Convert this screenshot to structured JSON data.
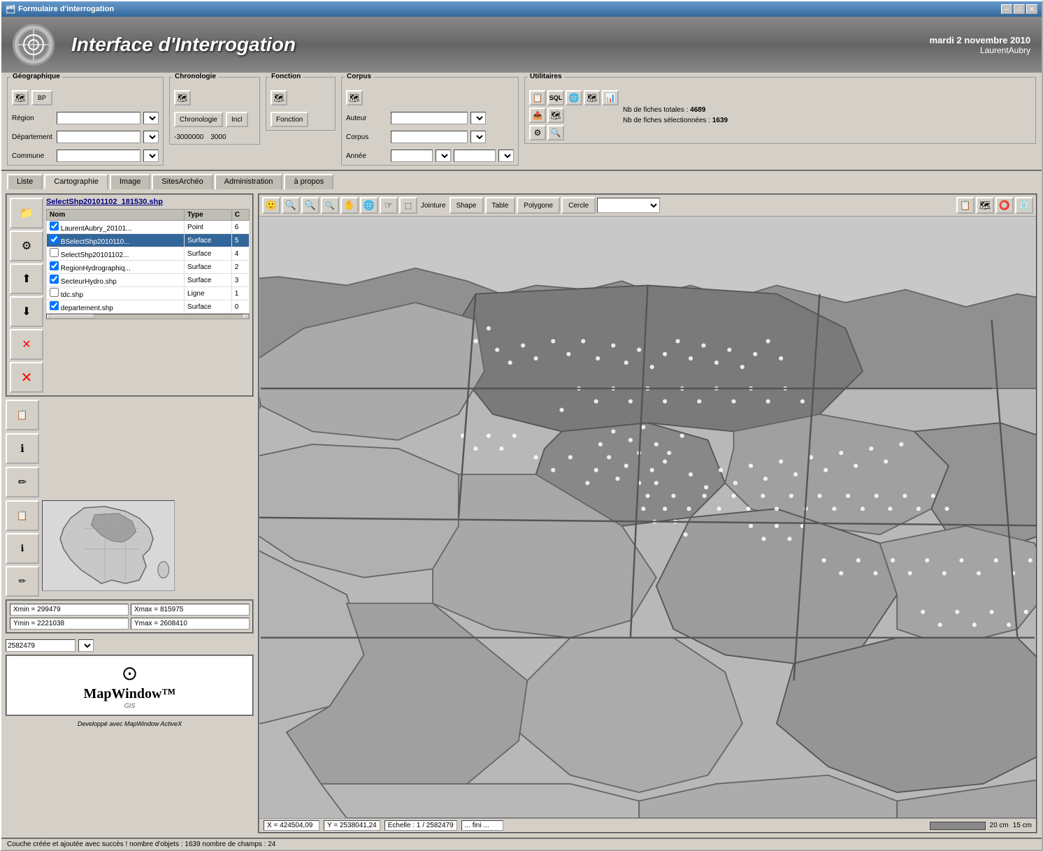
{
  "window": {
    "title": "Formulaire d'interrogation",
    "controls": {
      "minimize": "─",
      "maximize": "□",
      "close": "✕"
    }
  },
  "header": {
    "title": "Interface d'Interrogation",
    "date": "mardi 2 novembre 2010",
    "user": "LaurentAubry"
  },
  "toolbar": {
    "geo_label": "Géographique",
    "region_label": "Région",
    "dept_label": "Département",
    "commune_label": "Commune",
    "chron_label": "Chronologie",
    "chron_btn": "Chronologie",
    "incl_btn": "Incl",
    "chron_from": "-3000000",
    "chron_to": "3000",
    "fonction_label": "Fonction",
    "fonction_btn": "Fonction",
    "corpus_label": "Corpus",
    "auteur_label": "Auteur",
    "corpus_sub_label": "Corpus",
    "annee_label": "Année",
    "util_label": "Utilitaires",
    "nb_fiches_total_label": "Nb de fiches totales :",
    "nb_fiches_total": "4689",
    "nb_fiches_sel_label": "Nb de fiches sélectionnées :",
    "nb_fiches_sel": "1639"
  },
  "tabs": [
    {
      "id": "liste",
      "label": "Liste"
    },
    {
      "id": "cartographie",
      "label": "Cartographie",
      "active": true
    },
    {
      "id": "image",
      "label": "Image"
    },
    {
      "id": "sitesarcheo",
      "label": "SitesArchéo"
    },
    {
      "id": "administration",
      "label": "Administration"
    },
    {
      "id": "apropos",
      "label": "à propos"
    }
  ],
  "layers": {
    "shp_file": "SelectShp20101102_181530.shp",
    "columns": [
      "Nom",
      "Type",
      "C"
    ],
    "rows": [
      {
        "name": "LaurentAubry_20101...",
        "type": "Point",
        "c": "6",
        "checked": true,
        "selected": false
      },
      {
        "name": "BSelectShp2010110...",
        "type": "Surface",
        "c": "5",
        "checked": true,
        "selected": true
      },
      {
        "name": "SelectShp20101102...",
        "type": "Surface",
        "c": "4",
        "checked": false,
        "selected": false
      },
      {
        "name": "RegionHydrographiq...",
        "type": "Surface",
        "c": "2",
        "checked": true,
        "selected": false
      },
      {
        "name": "SecteurHydro.shp",
        "type": "Surface",
        "c": "3",
        "checked": true,
        "selected": false
      },
      {
        "name": "tdc.shp",
        "type": "Ligne",
        "c": "1",
        "checked": false,
        "selected": false
      },
      {
        "name": "departement.shp",
        "type": "Surface",
        "c": "0",
        "checked": true,
        "selected": false
      }
    ]
  },
  "coords": {
    "xmin_label": "Xmin = 299479",
    "xmax_label": "Xmax = 815975",
    "ymin_label": "Ymin = 2221038",
    "ymax_label": "Ymax = 2608410",
    "scale": "2582479"
  },
  "map_toolbar": {
    "jointure_label": "Jointure",
    "shape_btn": "Shape",
    "table_btn": "Table",
    "polygon_btn": "Polygone",
    "cercle_btn": "Cercle"
  },
  "map_status": {
    "x": "X = 424504,09",
    "y": "Y = 2538041,24",
    "echelle": "Echelle : 1 / 2582479",
    "state": "... fini ...",
    "scale_20": "20 cm",
    "scale_15": "15 cm"
  },
  "bottom_status": "Couche créée et ajoutée avec succès !   nombre d'objets : 1639   nombre de champs : 24",
  "mapwindow": {
    "logo": "MapWindow™",
    "sub": "GIS",
    "footer": "Developpé avec MapWindow ActiveX"
  }
}
